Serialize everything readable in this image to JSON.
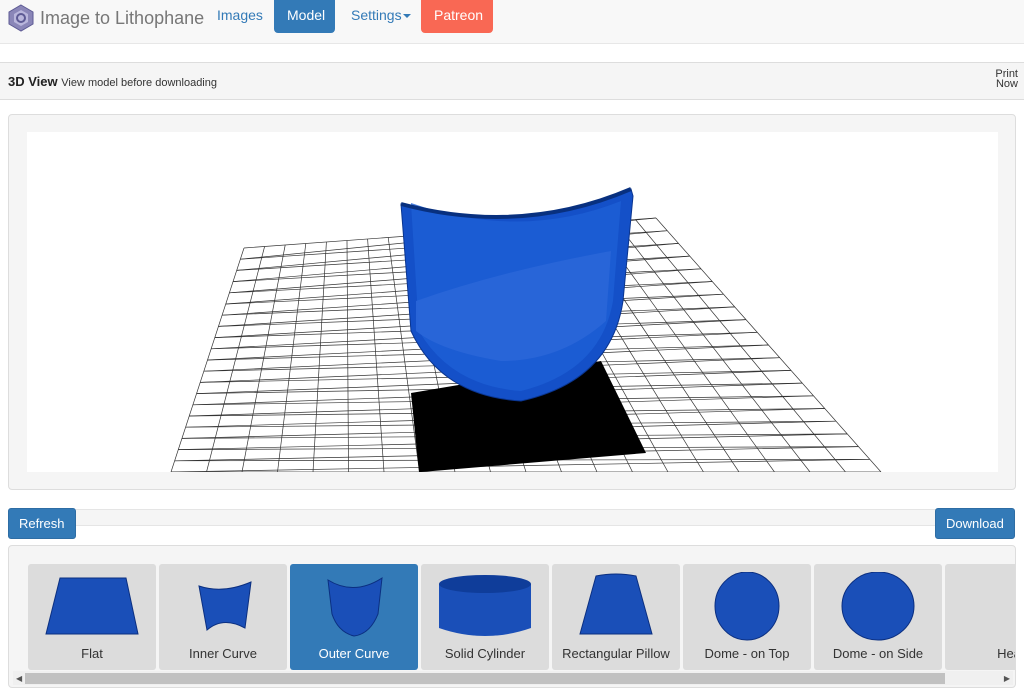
{
  "nav": {
    "brand": "Image to Lithophane",
    "links": [
      "Images",
      "Model",
      "Settings",
      "Patreon"
    ],
    "active": "Model"
  },
  "heading": {
    "title": "3D View",
    "subtitle": "View model before downloading",
    "print_line1": "Print",
    "print_line2": "Now"
  },
  "actions": {
    "refresh": "Refresh",
    "download": "Download"
  },
  "shapes": [
    {
      "label": "Flat"
    },
    {
      "label": "Inner Curve"
    },
    {
      "label": "Outer Curve",
      "selected": true
    },
    {
      "label": "Solid Cylinder"
    },
    {
      "label": "Rectangular Pillow"
    },
    {
      "label": "Dome - on Top"
    },
    {
      "label": "Dome - on Side"
    },
    {
      "label": "Hea"
    }
  ],
  "colors": {
    "primary": "#337ab7",
    "patreon": "#f96854",
    "model": "#1450c8"
  }
}
